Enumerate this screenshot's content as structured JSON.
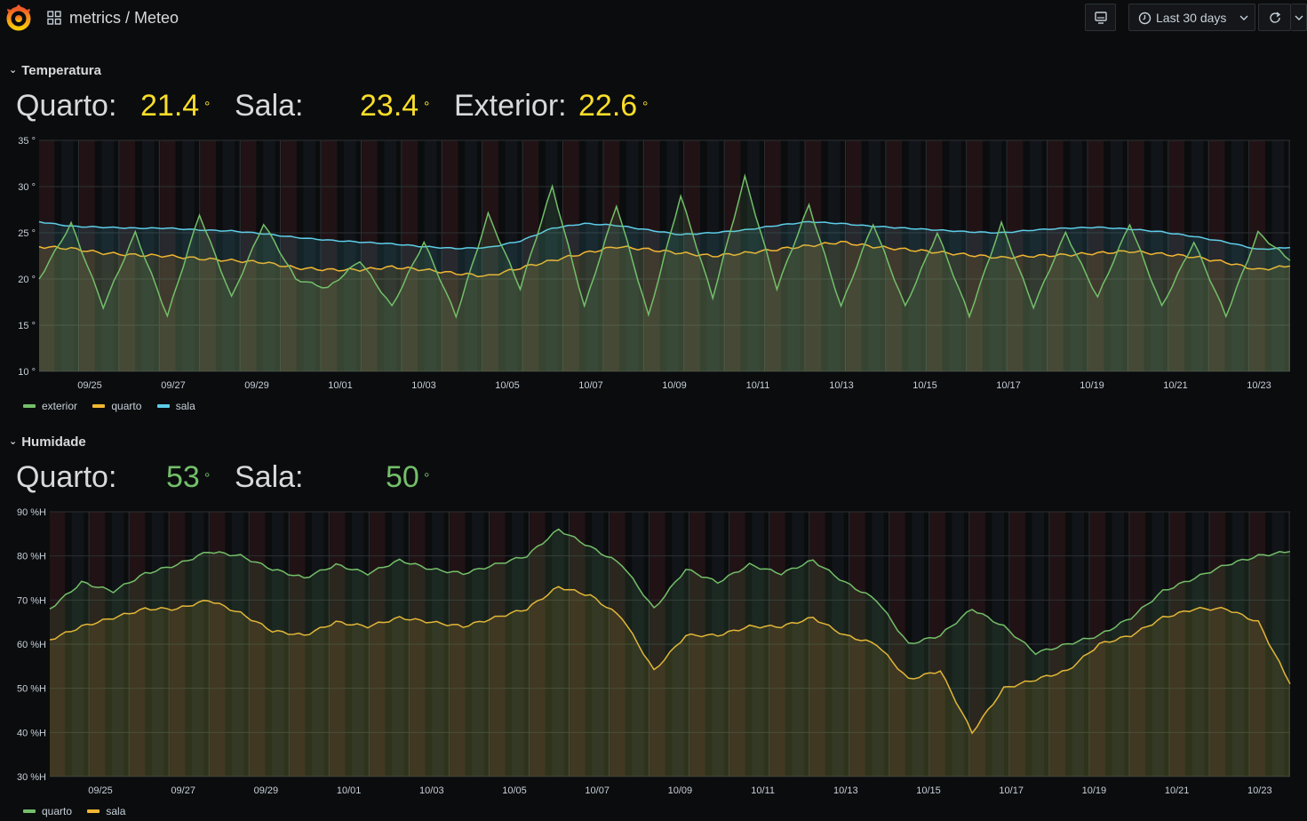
{
  "header": {
    "breadcrumb": "metrics / Meteo",
    "time_range": "Last 30 days",
    "icons": [
      "grafana-logo-icon",
      "dashboards-grid-icon",
      "tv-mode-icon",
      "clock-icon",
      "chevron-down-icon",
      "refresh-icon",
      "chevron-down-icon"
    ]
  },
  "colors": {
    "green": "#73bf69",
    "orange": "#f2b632",
    "cyan": "#5dcde8",
    "yellow": "#fade2a",
    "statGreen": "#73bf69"
  },
  "temperature": {
    "row_title": "Temperatura",
    "stats": [
      {
        "label": "Quarto:",
        "value": "21.4",
        "unit": "°"
      },
      {
        "label": "Sala:",
        "value": "23.4",
        "unit": "°"
      },
      {
        "label": "Exterior:",
        "value": "22.6",
        "unit": "°"
      }
    ],
    "legend": [
      {
        "name": "exterior",
        "color": "#73bf69"
      },
      {
        "name": "quarto",
        "color": "#f2b632"
      },
      {
        "name": "sala",
        "color": "#5dcde8"
      }
    ]
  },
  "humidity": {
    "row_title": "Humidade",
    "stats": [
      {
        "label": "Quarto:",
        "value": "53",
        "unit": "°"
      },
      {
        "label": "Sala:",
        "value": "50",
        "unit": "°"
      }
    ],
    "legend": [
      {
        "name": "quarto",
        "color": "#73bf69"
      },
      {
        "name": "sala",
        "color": "#f2b632"
      }
    ]
  },
  "chart_data": [
    {
      "type": "line",
      "title": "",
      "x": [
        "09/25",
        "09/27",
        "09/29",
        "10/01",
        "10/03",
        "10/05",
        "10/07",
        "10/09",
        "10/11",
        "10/13",
        "10/15",
        "10/17",
        "10/19",
        "10/21",
        "10/23"
      ],
      "y_ticks": [
        "35 °",
        "30 °",
        "25 °",
        "20 °",
        "15 °",
        "10 °"
      ],
      "ylim": [
        10,
        35
      ],
      "unit": "°",
      "series": [
        {
          "name": "exterior",
          "values": [
            20,
            26,
            17,
            25,
            16,
            27,
            18,
            26,
            20,
            19,
            22,
            17,
            24,
            16,
            27,
            19,
            30,
            17,
            28,
            16,
            29,
            18,
            31,
            19,
            28,
            17,
            26,
            17,
            25,
            16,
            26,
            17,
            25,
            18,
            26,
            17,
            24,
            16,
            25,
            22
          ]
        },
        {
          "name": "quarto",
          "values": [
            23.5,
            23.3,
            22.8,
            22.6,
            22.5,
            22.2,
            22.0,
            21.8,
            21.2,
            21.0,
            21.0,
            21.3,
            21.0,
            20.6,
            20.3,
            21.2,
            22.0,
            22.8,
            23.5,
            23.2,
            22.8,
            22.5,
            22.8,
            23.2,
            23.6,
            24.0,
            23.5,
            23.2,
            22.9,
            22.6,
            22.3,
            22.5,
            22.6,
            22.8,
            23.0,
            22.7,
            22.4,
            21.8,
            21.0,
            21.4
          ]
        },
        {
          "name": "sala",
          "values": [
            26.2,
            25.7,
            25.6,
            25.5,
            25.5,
            25.3,
            25.2,
            24.9,
            24.5,
            24.2,
            24.0,
            23.8,
            23.5,
            23.3,
            23.4,
            24.1,
            25.5,
            26.0,
            25.8,
            25.3,
            24.8,
            25.0,
            25.3,
            25.8,
            26.2,
            26.0,
            25.7,
            25.5,
            25.3,
            25.1,
            25.0,
            25.3,
            25.5,
            25.6,
            25.4,
            25.1,
            24.6,
            24.0,
            23.2,
            23.4
          ]
        }
      ]
    },
    {
      "type": "line",
      "title": "",
      "x": [
        "09/25",
        "09/27",
        "09/29",
        "10/01",
        "10/03",
        "10/05",
        "10/07",
        "10/09",
        "10/11",
        "10/13",
        "10/15",
        "10/17",
        "10/19",
        "10/21",
        "10/23"
      ],
      "y_ticks": [
        "90 %H",
        "80 %H",
        "70 %H",
        "60 %H",
        "50 %H",
        "40 %H",
        "30 %H"
      ],
      "ylim": [
        30,
        90
      ],
      "unit": "%H",
      "series": [
        {
          "name": "quarto",
          "values": [
            68,
            74,
            72,
            76,
            78,
            81,
            80,
            77,
            75,
            78,
            76,
            79,
            77,
            76,
            78,
            80,
            86,
            82,
            78,
            68,
            77,
            74,
            78,
            76,
            79,
            74,
            70,
            60,
            62,
            68,
            64,
            58,
            60,
            62,
            66,
            72,
            75,
            78,
            80,
            81
          ]
        },
        {
          "name": "sala",
          "values": [
            61,
            64,
            66,
            68,
            68,
            70,
            67,
            63,
            62,
            65,
            64,
            66,
            65,
            64,
            66,
            68,
            73,
            71,
            66,
            54,
            62,
            62,
            64,
            64,
            66,
            62,
            60,
            52,
            54,
            40,
            50,
            52,
            54,
            60,
            62,
            66,
            68,
            68,
            65,
            51
          ]
        }
      ]
    }
  ]
}
